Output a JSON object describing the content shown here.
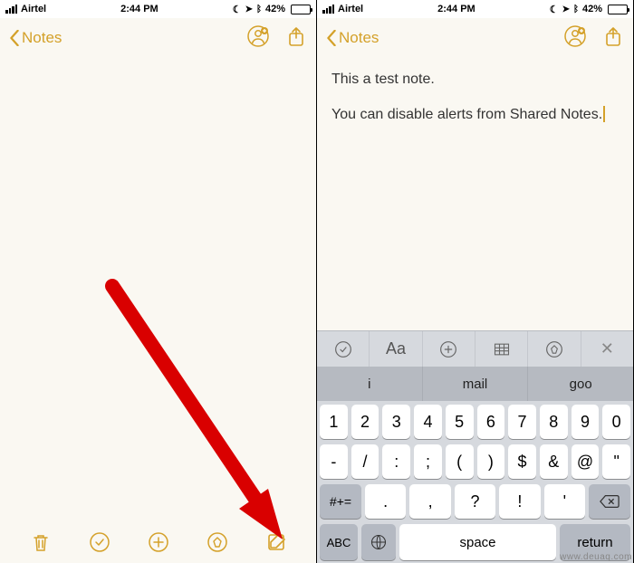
{
  "status": {
    "carrier": "Airtel",
    "time": "2:44 PM",
    "battery_pct": "42%"
  },
  "nav": {
    "back_label": "Notes"
  },
  "note": {
    "line1": "This a test note.",
    "line2": "You can disable alerts from Shared Notes."
  },
  "kb": {
    "accessory_aa": "Aa",
    "suggest": [
      "i",
      "mail",
      "goo"
    ],
    "row1": [
      "1",
      "2",
      "3",
      "4",
      "5",
      "6",
      "7",
      "8",
      "9",
      "0"
    ],
    "row2": [
      "-",
      "/",
      ":",
      ";",
      "(",
      ")",
      "$",
      "&",
      "@",
      "\""
    ],
    "shift": "#+=",
    "row3": [
      ".",
      ",",
      "?",
      "!",
      "'"
    ],
    "abc": "ABC",
    "space": "space",
    "return": "return"
  },
  "watermark": "www.deuaq.com"
}
